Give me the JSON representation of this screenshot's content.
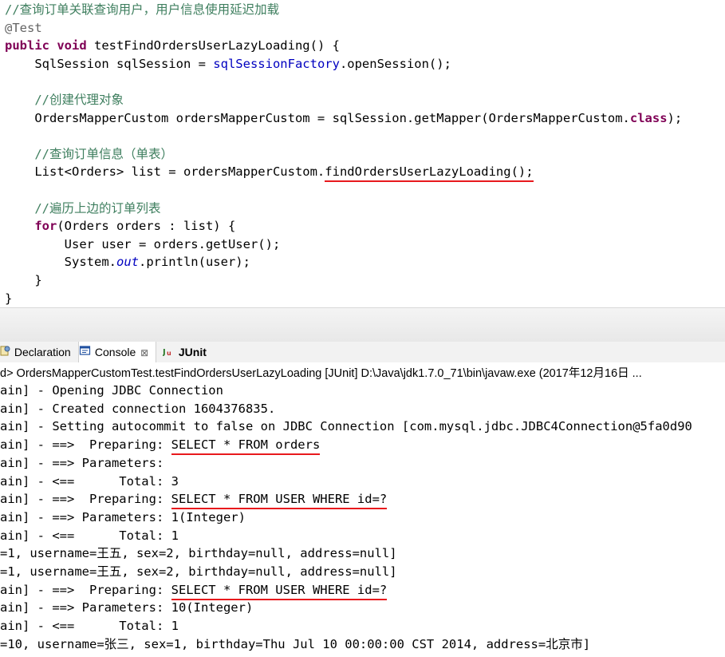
{
  "editor": {
    "lines": [
      {
        "parts": [
          {
            "t": "//查询订单关联查询用户，用户信息使用延迟加载",
            "c": "cmt"
          }
        ]
      },
      {
        "parts": [
          {
            "t": "@Test",
            "c": "ann"
          }
        ]
      },
      {
        "parts": [
          {
            "t": "public",
            "c": "kw"
          },
          {
            "t": " "
          },
          {
            "t": "void",
            "c": "kw"
          },
          {
            "t": " testFindOrdersUserLazyLoading() {"
          }
        ]
      },
      {
        "parts": [
          {
            "t": "    SqlSession sqlSession = "
          },
          {
            "t": "sqlSessionFactory",
            "c": "fld"
          },
          {
            "t": ".openSession();"
          }
        ]
      },
      {
        "parts": []
      },
      {
        "parts": [
          {
            "t": "    "
          },
          {
            "t": "//创建代理对象",
            "c": "cmt"
          }
        ]
      },
      {
        "parts": [
          {
            "t": "    OrdersMapperCustom ordersMapperCustom = sqlSession.getMapper(OrdersMapperCustom."
          },
          {
            "t": "class",
            "c": "kw"
          },
          {
            "t": ");"
          }
        ]
      },
      {
        "parts": []
      },
      {
        "parts": [
          {
            "t": "    "
          },
          {
            "t": "//查询订单信息（单表）",
            "c": "cmt"
          }
        ]
      },
      {
        "parts": [
          {
            "t": "    List<Orders> list = ordersMapperCustom."
          },
          {
            "t": "findOrdersUserLazyLoading();",
            "c": "ul"
          }
        ]
      },
      {
        "parts": []
      },
      {
        "parts": [
          {
            "t": "    "
          },
          {
            "t": "//遍历上边的订单列表",
            "c": "cmt"
          }
        ]
      },
      {
        "parts": [
          {
            "t": "    "
          },
          {
            "t": "for",
            "c": "kw"
          },
          {
            "t": "(Orders orders : list) {"
          }
        ]
      },
      {
        "parts": [
          {
            "t": "        User user = orders.getUser();"
          }
        ]
      },
      {
        "parts": [
          {
            "t": "        System."
          },
          {
            "t": "out",
            "c": "sfld"
          },
          {
            "t": ".println(user);"
          }
        ]
      },
      {
        "parts": [
          {
            "t": "    }"
          }
        ]
      },
      {
        "parts": [
          {
            "t": "}"
          }
        ]
      }
    ]
  },
  "tabs": [
    {
      "label": "Declaration",
      "icon": "declaration-icon"
    },
    {
      "label": "Console",
      "icon": "console-icon",
      "close": "⊠"
    },
    {
      "label": "JUnit",
      "icon": "junit-icon"
    }
  ],
  "console": {
    "header": "d> OrdersMapperCustomTest.testFindOrdersUserLazyLoading [JUnit] D:\\Java\\jdk1.7.0_71\\bin\\javaw.exe (2017年12月16日 ...",
    "lines": [
      {
        "parts": [
          {
            "t": "ain] - Opening JDBC Connection"
          }
        ]
      },
      {
        "parts": [
          {
            "t": "ain] - Created connection 1604376835."
          }
        ]
      },
      {
        "parts": [
          {
            "t": "ain] - Setting autocommit to false on JDBC Connection [com.mysql.jdbc.JDBC4Connection@5fa0d90"
          }
        ]
      },
      {
        "parts": [
          {
            "t": "ain] - ==>  Preparing: "
          },
          {
            "t": "SELECT * FROM orders",
            "c": "ul"
          }
        ]
      },
      {
        "parts": [
          {
            "t": "ain] - ==> Parameters: "
          }
        ]
      },
      {
        "parts": [
          {
            "t": "ain] - <==      Total: 3"
          }
        ]
      },
      {
        "parts": [
          {
            "t": "ain] - ==>  Preparing: "
          },
          {
            "t": "SELECT * FROM USER WHERE id=?",
            "c": "ul"
          }
        ]
      },
      {
        "parts": [
          {
            "t": "ain] - ==> Parameters: 1(Integer)"
          }
        ]
      },
      {
        "parts": [
          {
            "t": "ain] - <==      Total: 1"
          }
        ]
      },
      {
        "parts": [
          {
            "t": "=1, username=王五, sex=2, birthday=null, address=null]"
          }
        ]
      },
      {
        "parts": [
          {
            "t": "=1, username=王五, sex=2, birthday=null, address=null]"
          }
        ]
      },
      {
        "parts": [
          {
            "t": "ain] - ==>  Preparing: "
          },
          {
            "t": "SELECT * FROM USER WHERE id=?",
            "c": "ul"
          }
        ]
      },
      {
        "parts": [
          {
            "t": "ain] - ==> Parameters: 10(Integer)"
          }
        ]
      },
      {
        "parts": [
          {
            "t": "ain] - <==      Total: 1"
          }
        ]
      },
      {
        "parts": [
          {
            "t": "=10, username=张三, sex=1, birthday=Thu Jul 10 00:00:00 CST 2014, address=北京市]"
          }
        ]
      }
    ]
  },
  "colors": {
    "comment": "#3f7f5f",
    "keyword": "#7f0055",
    "field": "#0000c0",
    "annotation": "#646464",
    "underline": "#e8191d"
  }
}
